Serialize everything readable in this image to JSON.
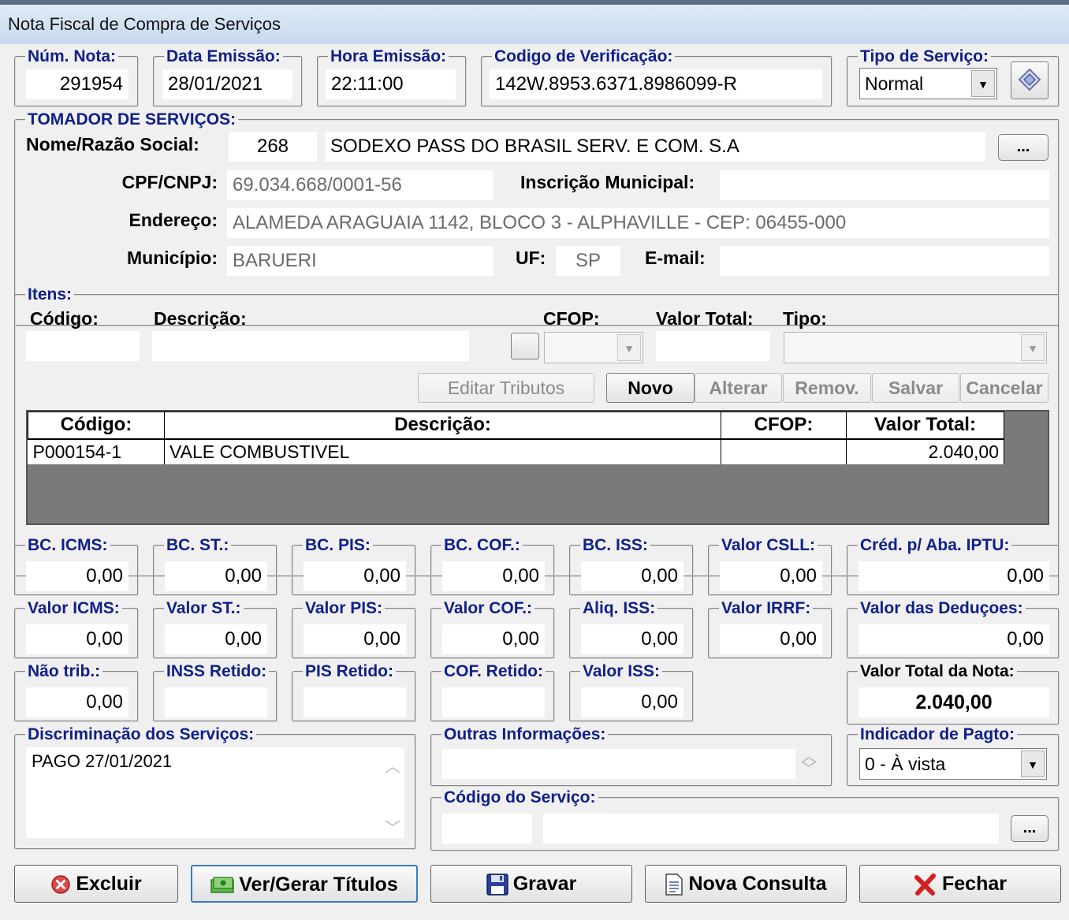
{
  "window": {
    "title": "Nota Fiscal de Compra de Serviços"
  },
  "header": {
    "num_nota": {
      "label": "Núm. Nota:",
      "value": "291954"
    },
    "data_emissao": {
      "label": "Data Emissão:",
      "value": "28/01/2021"
    },
    "hora_emissao": {
      "label": "Hora Emissão:",
      "value": "22:11:00"
    },
    "codigo_verificacao": {
      "label": "Codigo de Verificação:",
      "value": "142W.8953.6371.8986099-R"
    },
    "tipo_servico": {
      "label": "Tipo de Serviço:",
      "value": "Normal"
    }
  },
  "tomador": {
    "legend": "TOMADOR DE SERVIÇOS:",
    "nome_label": "Nome/Razão Social:",
    "codigo": "268",
    "nome": "SODEXO PASS DO BRASIL SERV. E COM. S.A",
    "lookup_label": "...",
    "cpf_label": "CPF/CNPJ:",
    "cpf": "69.034.668/0001-56",
    "inscricao_label": "Inscrição Municipal:",
    "inscricao": "",
    "endereco_label": "Endereço:",
    "endereco": "ALAMEDA ARAGUAIA 1142, BLOCO 3 - ALPHAVILLE - CEP: 06455-000",
    "municipio_label": "Município:",
    "municipio": "BARUERI",
    "uf_label": "UF:",
    "uf": "SP",
    "email_label": "E-mail:",
    "email": ""
  },
  "itens": {
    "legend": "Itens:",
    "codigo_label": "Código:",
    "descricao_label": "Descrição:",
    "cfop_label": "CFOP:",
    "valor_total_label": "Valor Total:",
    "tipo_label": "Tipo:",
    "buttons": {
      "editar_tributos": "Editar Tributos",
      "novo": "Novo",
      "alterar": "Alterar",
      "remover": "Remov.",
      "salvar": "Salvar",
      "cancelar": "Cancelar"
    },
    "grid": {
      "columns": [
        "Código:",
        "Descrição:",
        "CFOP:",
        "Valor Total:"
      ],
      "rows": [
        {
          "codigo": "P000154-1",
          "descricao": "VALE COMBUSTIVEL",
          "cfop": "",
          "valor_total": "2.040,00"
        }
      ]
    }
  },
  "totais": {
    "bc_icms": {
      "label": "BC. ICMS:",
      "value": "0,00"
    },
    "bc_st": {
      "label": "BC. ST.:",
      "value": "0,00"
    },
    "bc_pis": {
      "label": "BC. PIS:",
      "value": "0,00"
    },
    "bc_cof": {
      "label": "BC. COF.:",
      "value": "0,00"
    },
    "bc_iss": {
      "label": "BC. ISS:",
      "value": "0,00"
    },
    "valor_csll": {
      "label": "Valor CSLL:",
      "value": "0,00"
    },
    "cred_iptu": {
      "label": "Créd. p/ Aba. IPTU:",
      "value": "0,00"
    },
    "valor_icms": {
      "label": "Valor ICMS:",
      "value": "0,00"
    },
    "valor_st": {
      "label": "Valor ST.:",
      "value": "0,00"
    },
    "valor_pis": {
      "label": "Valor PIS:",
      "value": "0,00"
    },
    "valor_cof": {
      "label": "Valor COF.:",
      "value": "0,00"
    },
    "aliq_iss": {
      "label": "Aliq. ISS:",
      "value": "0,00"
    },
    "valor_irrf": {
      "label": "Valor IRRF:",
      "value": "0,00"
    },
    "valor_deducoes": {
      "label": "Valor das Deduçoes:",
      "value": "0,00"
    },
    "nao_trib": {
      "label": "Não trib.:",
      "value": "0,00"
    },
    "inss_retido": {
      "label": "INSS Retido:",
      "value": ""
    },
    "pis_retido": {
      "label": "PIS Retido:",
      "value": ""
    },
    "cof_retido": {
      "label": "COF. Retido:",
      "value": ""
    },
    "valor_iss": {
      "label": "Valor ISS:",
      "value": "0,00"
    },
    "valor_total_nota": {
      "label": "Valor Total da Nota:",
      "value": "2.040,00"
    }
  },
  "discriminacao": {
    "label": "Discriminação dos Serviços:",
    "value": "PAGO 27/01/2021"
  },
  "outras_informacoes": {
    "label": "Outras Informações:",
    "value": ""
  },
  "indicador_pagto": {
    "label": "Indicador de Pagto:",
    "value": "0 - À vista"
  },
  "codigo_servico": {
    "label": "Código do Serviço:",
    "codigo": "",
    "descricao": "",
    "lookup_label": "..."
  },
  "footer": {
    "excluir": "Excluir",
    "ver_gerar_titulos": "Ver/Gerar Títulos",
    "gravar": "Gravar",
    "nova_consulta": "Nova Consulta",
    "fechar": "Fechar"
  }
}
